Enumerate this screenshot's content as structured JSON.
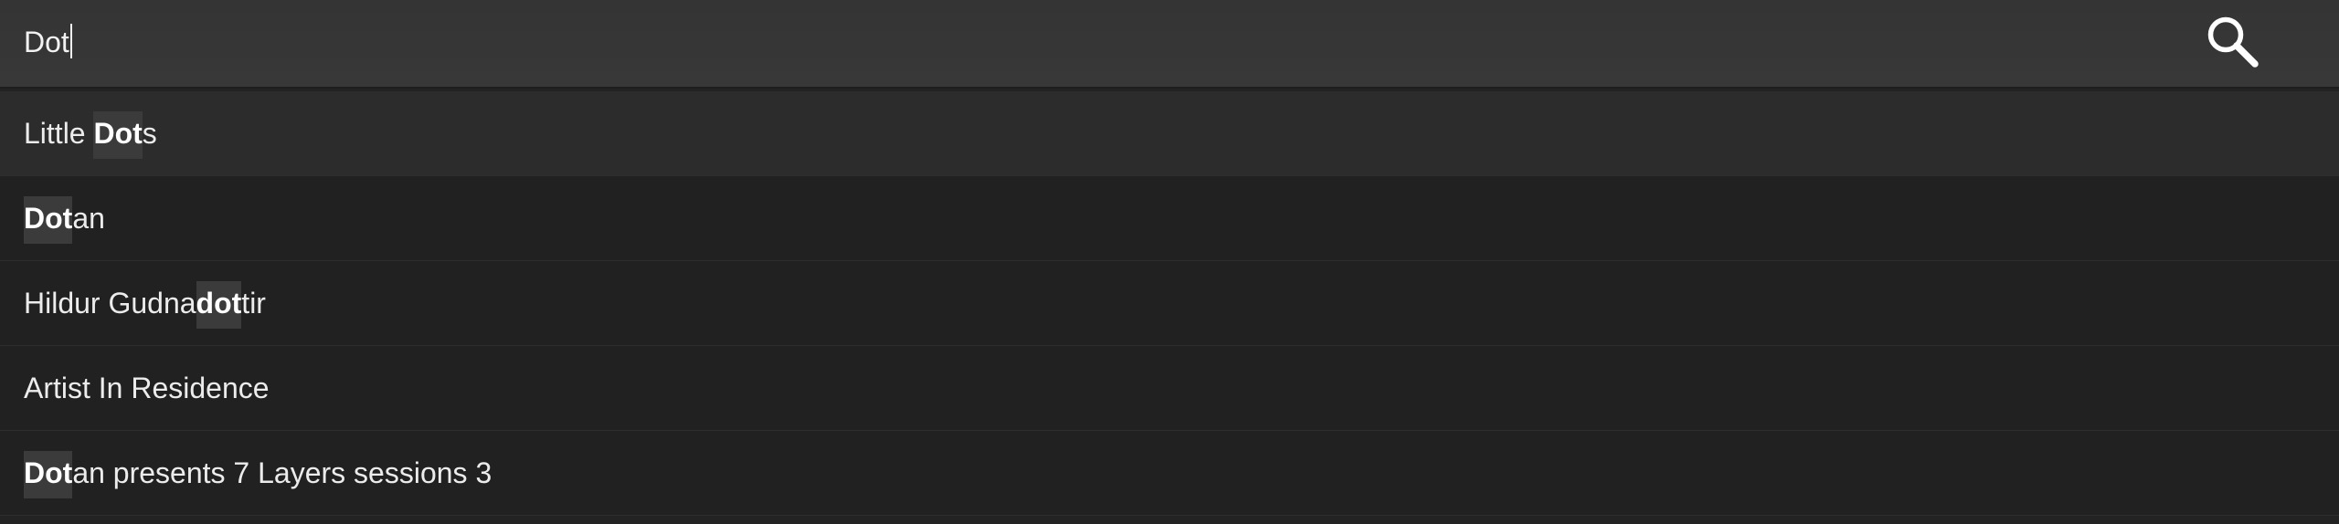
{
  "search": {
    "query": "Dot",
    "button_icon": "search-icon"
  },
  "suggestions": [
    {
      "pre": "Little ",
      "match": "Dot",
      "post": "s"
    },
    {
      "pre": "",
      "match": "Dot",
      "post": "an"
    },
    {
      "pre": "Hildur Gudna",
      "match": "dot",
      "post": "tir"
    },
    {
      "pre": "Artist In Residence",
      "match": "",
      "post": ""
    },
    {
      "pre": "",
      "match": "Dot",
      "post": "an presents 7 Layers sessions 3"
    }
  ],
  "colors": {
    "bar_bg": "#363636",
    "list_bg": "#222121",
    "active_row_bg": "#2c2c2c",
    "highlight_bg": "#3b3b3b",
    "text": "#ececec"
  }
}
